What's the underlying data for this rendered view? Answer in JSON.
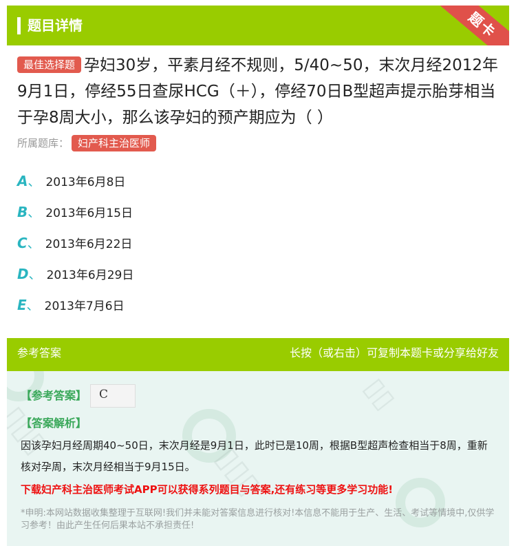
{
  "header": {
    "title": "题目详情",
    "ribbon": "题卡"
  },
  "question": {
    "badge": "最佳选择题",
    "text": "孕妇30岁，平素月经不规则，5/40~50，末次月经2012年9月1日，停经55日查尿HCG（＋），停经70日B型超声提示胎芽相当于孕8周大小，那么该孕妇的预产期应为（ ）",
    "bank_label": "所属题库：",
    "bank": "妇产科主治医师"
  },
  "options": [
    {
      "letter": "A",
      "sep": "、",
      "text": "2013年6月8日"
    },
    {
      "letter": "B",
      "sep": "、",
      "text": "2013年6月15日"
    },
    {
      "letter": "C",
      "sep": "、",
      "text": "2013年6月22日"
    },
    {
      "letter": "D",
      "sep": "、",
      "text": "2013年6月29日"
    },
    {
      "letter": "E",
      "sep": "、",
      "text": "2013年7月6日"
    }
  ],
  "answer": {
    "header_left": "参考答案",
    "header_right": "长按（或右击）可复制本题卡或分享给好友",
    "ref_label": "【参考答案】",
    "ref_value": "C",
    "analysis_label": "【答案解析】",
    "analysis": "因该孕妇月经周期40~50日，末次月经是9月1日，此时已是10周，根据B型超声检查相当于8周，重新核对孕周，末次月经相当于9月15日。",
    "promo": "下载妇产科主治医师考试APP可以获得系列题目与答案,还有练习等更多学习功能!",
    "disclaimer": "*申明:本网站数据收集整理于互联网!我们并未能对答案信息进行核对!本信息不能用于生产、生活、考试等情境中,仅供学习参考！由此产生任何后果本站不承担责任!"
  },
  "colors": {
    "brand_green": "#99cc00",
    "badge_red": "#e25a4e",
    "option_teal": "#2ab5c0",
    "answer_bg": "#e9f5f2",
    "promo_red": "#ee1111"
  }
}
